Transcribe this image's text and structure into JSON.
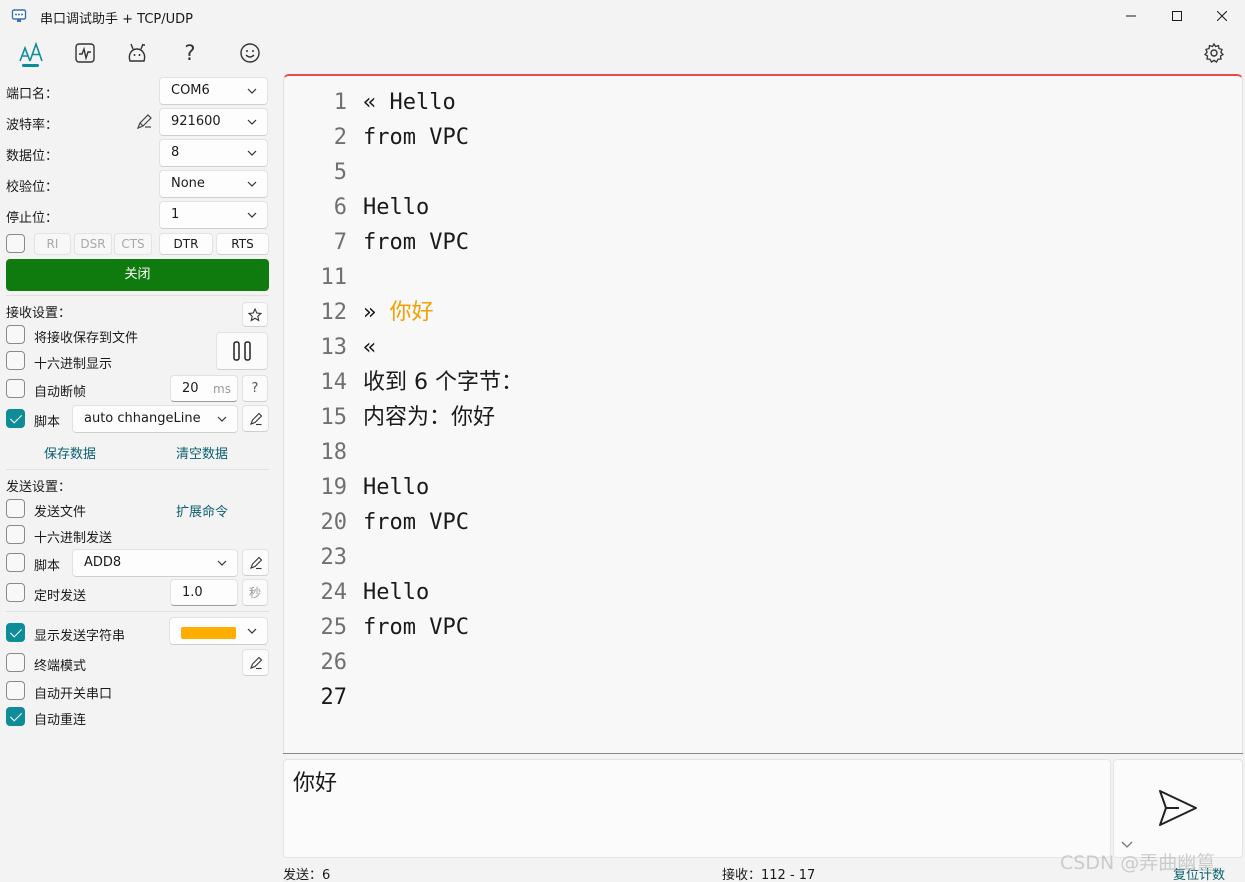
{
  "window": {
    "title": "串口调试助手 + TCP/UDP",
    "minimize_glyph": "─",
    "maximize_glyph": "☐",
    "close_glyph": "✕"
  },
  "toolbar": {
    "icons": [
      "font-icon",
      "activity-icon",
      "debug-icon",
      "help-icon",
      "smile-icon",
      "gear-icon"
    ],
    "help_glyph": "?"
  },
  "serial": {
    "port_label": "端口名：",
    "port_value": "COM6",
    "baud_label": "波特率：",
    "baud_value": "921600",
    "databits_label": "数据位：",
    "databits_value": "8",
    "parity_label": "校验位：",
    "parity_value": "None",
    "stopbits_label": "停止位：",
    "stopbits_value": "1",
    "signals": [
      "RI",
      "DSR",
      "CTS",
      "DTR",
      "RTS"
    ],
    "close_label": "关闭"
  },
  "receive_settings": {
    "title": "接收设置：",
    "save_to_file": "将接收保存到文件",
    "hex_display": "十六进制显示",
    "auto_frame": "自动断帧",
    "auto_frame_value": "20",
    "auto_frame_unit": "ms",
    "auto_frame_help": "?",
    "script_label": "脚本",
    "script_value": "auto chhangeLine",
    "save_data": "保存数据",
    "clear_data": "清空数据"
  },
  "send_settings": {
    "title": "发送设置：",
    "send_file": "发送文件",
    "extend_cmd": "扩展命令",
    "hex_send": "十六进制发送",
    "script_label": "脚本",
    "script_value": "ADD8",
    "timed_send": "定时发送",
    "timed_value": "1.0",
    "timed_unit": "秒",
    "show_send_string": "显示发送字符串",
    "send_string_color": "#ffad00",
    "terminal_mode": "终端模式",
    "auto_switch_port": "自动开关串口",
    "auto_reconnect": "自动重连"
  },
  "receive_lines": [
    {
      "num": "1",
      "text": "« Hello"
    },
    {
      "num": "2",
      "text": "from VPC"
    },
    {
      "num": "5",
      "text": ""
    },
    {
      "num": "6",
      "text": "Hello"
    },
    {
      "num": "7",
      "text": "from VPC"
    },
    {
      "num": "11",
      "text": ""
    },
    {
      "num": "12",
      "text": "» ",
      "highlight": "你好"
    },
    {
      "num": "13",
      "text": "«"
    },
    {
      "num": "14",
      "text": "收到 6 个字节："
    },
    {
      "num": "15",
      "text": "内容为：你好"
    },
    {
      "num": "18",
      "text": ""
    },
    {
      "num": "19",
      "text": "Hello"
    },
    {
      "num": "20",
      "text": "from VPC"
    },
    {
      "num": "23",
      "text": ""
    },
    {
      "num": "24",
      "text": "Hello"
    },
    {
      "num": "25",
      "text": "from VPC"
    },
    {
      "num": "26",
      "text": ""
    },
    {
      "num": "27",
      "text": ""
    }
  ],
  "send_input": {
    "value": "你好"
  },
  "status": {
    "sent": "发送：6",
    "received": "接收：112  -  17",
    "reset_count": "复位计数"
  },
  "watermark": "CSDN @弄曲幽篁",
  "colors": {
    "accent": "#0e8c97",
    "close_button": "#0f7b0f",
    "highlight": "#f2a000",
    "top_border": "#e94a4a"
  }
}
